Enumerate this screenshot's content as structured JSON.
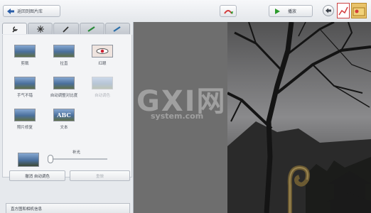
{
  "topbar": {
    "back_label": "返回到图片库",
    "play_label": "播放"
  },
  "tabs": [
    {
      "icon": "wrench-icon"
    },
    {
      "icon": "sparkle-icon"
    },
    {
      "icon": "brush-icon"
    },
    {
      "icon": "paint-brush-icon"
    },
    {
      "icon": "paint-brush-blue-icon"
    }
  ],
  "tools": [
    {
      "label": "剪裁"
    },
    {
      "label": "拉直"
    },
    {
      "label": "红眼"
    },
    {
      "label": "手气不错"
    },
    {
      "label": "自动调整对比度"
    },
    {
      "label": "自动调色"
    },
    {
      "label": "照片修复"
    },
    {
      "label": "文本"
    }
  ],
  "text_tool_glyph": "ABC",
  "slider": {
    "label": "补光",
    "value": 0
  },
  "buttons": {
    "undo": "撤消 自动调色",
    "redo": "重做"
  },
  "histogram_label": "直方图和相机信息",
  "watermark": {
    "big": "GXI网",
    "small": "system.com"
  },
  "colors": {
    "accent_blue": "#2b5ea8",
    "play_green": "#2b9a2b",
    "red": "#d43c3c"
  }
}
